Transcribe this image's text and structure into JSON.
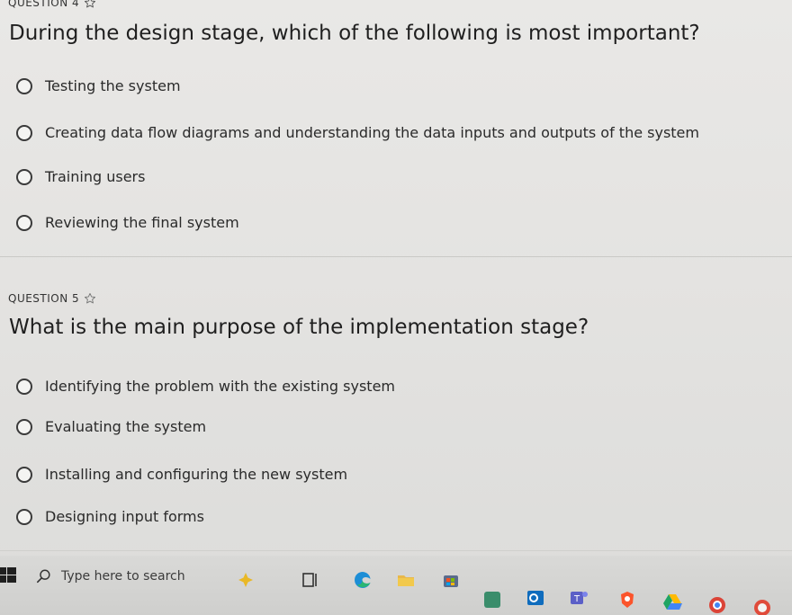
{
  "questions": [
    {
      "header": "QUESTION 4",
      "text": "During the design stage, which of the following is most important?",
      "options": [
        "Testing the system",
        "Creating data flow diagrams and understanding the data inputs and outputs of the system",
        "Training users",
        "Reviewing the final system"
      ]
    },
    {
      "header": "QUESTION 5",
      "text": "What is the main purpose of the implementation stage?",
      "options": [
        "Identifying the problem with the existing system",
        "Evaluating the system",
        "Installing and configuring the new system",
        "Designing input forms"
      ]
    }
  ],
  "taskbar": {
    "search_placeholder": "Type here to search",
    "icons": [
      "windows-start-icon",
      "search-icon",
      "weather-icon",
      "task-view-icon",
      "edge-icon",
      "file-explorer-icon",
      "store-icon",
      "outlook-icon",
      "teams-icon",
      "brave-icon",
      "app-icon",
      "google-drive-icon",
      "chrome-icon"
    ]
  },
  "colors": {
    "background": "#e6e5e3",
    "text": "#1f1f1f",
    "taskbar": "#d4d4d2"
  }
}
